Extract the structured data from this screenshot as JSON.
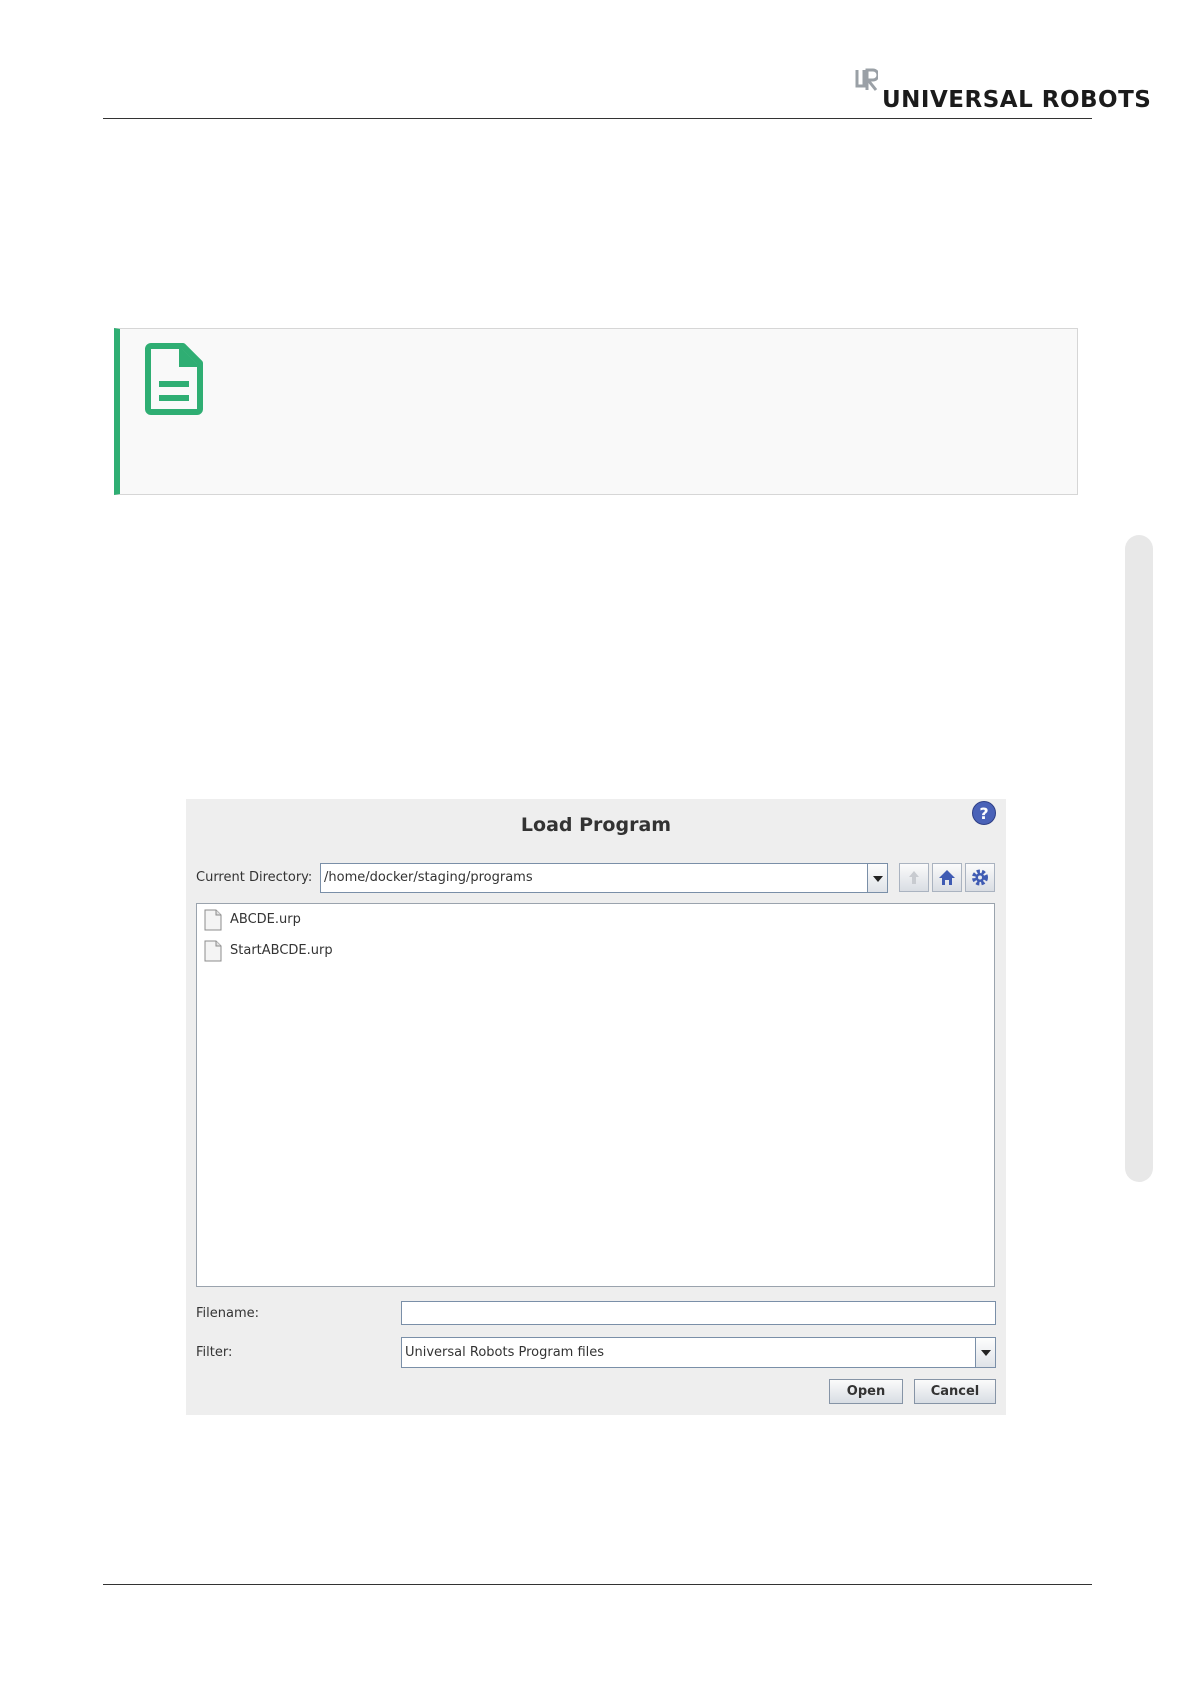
{
  "header": {
    "brand_text": "UNIVERSAL ROBOTS",
    "brand_mark": "UR"
  },
  "note": {
    "icon": "document-note-icon",
    "accent_color": "#2fae73"
  },
  "dialog": {
    "title": "Load Program",
    "help_label": "?",
    "current_directory_label": "Current Directory:",
    "current_directory_value": "/home/docker/staging/programs",
    "files": [
      {
        "name": "ABCDE.urp"
      },
      {
        "name": "StartABCDE.urp"
      }
    ],
    "filename_label": "Filename:",
    "filename_value": "",
    "filter_label": "Filter:",
    "filter_value": "Universal Robots Program files",
    "open_label": "Open",
    "cancel_label": "Cancel"
  }
}
